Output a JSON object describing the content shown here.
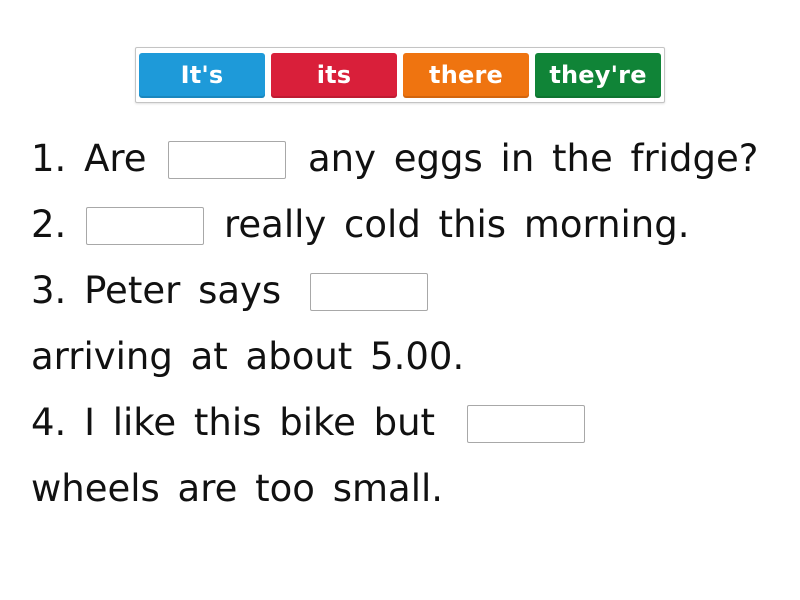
{
  "word_bank": {
    "chips": [
      {
        "label": "It's",
        "color": "#1e9ad9"
      },
      {
        "label": "its",
        "color": "#d91f3a"
      },
      {
        "label": "there",
        "color": "#ef7410"
      },
      {
        "label": "they're",
        "color": "#108437"
      }
    ]
  },
  "sentences": [
    {
      "prefix": "1. Are",
      "suffix": "any eggs in the fridge?",
      "blank_value": ""
    },
    {
      "prefix": "2.",
      "suffix": "really cold this morning.",
      "blank_value": ""
    },
    {
      "prefix": "3. Peter says",
      "suffix": "arriving at about 5.00.",
      "blank_value": ""
    },
    {
      "prefix": "4. I like this bike but",
      "suffix": "wheels are too small.",
      "blank_value": ""
    }
  ]
}
